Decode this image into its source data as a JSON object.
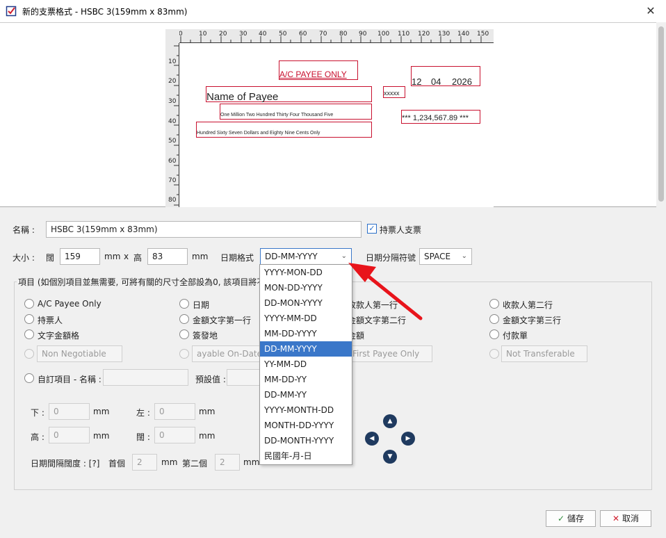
{
  "window": {
    "title": "新的支票格式 - HSBC 3(159mm x 83mm)"
  },
  "ruler": {
    "top_ticks": [
      "0",
      "10",
      "20",
      "30",
      "40",
      "50",
      "60",
      "70",
      "80",
      "90",
      "100",
      "110",
      "120",
      "130",
      "140",
      "150"
    ],
    "left_ticks": [
      "10",
      "20",
      "30",
      "40",
      "50",
      "60",
      "70",
      "80"
    ]
  },
  "cheque": {
    "ac_payee": "A/C PAYEE ONLY",
    "date_day": "12",
    "date_month": "04",
    "date_year": "2026",
    "payee": "Name of Payee",
    "xxxxx": "xxxxx",
    "words_line1": "One Million Two Hundred Thirty Four Thousand Five",
    "amount": "*** 1,234,567.89 ***",
    "words_line2": "Hundred Sixty Seven Dollars and Eighty Nine Cents Only"
  },
  "form": {
    "name_label": "名稱 :",
    "name_value": "HSBC 3(159mm x 83mm)",
    "bearer_label": "持票人支票",
    "size_label": "大小 :",
    "width_label": "闊",
    "width_value": "159",
    "mm1": "mm",
    "x": "x",
    "height_label": "高",
    "height_value": "83",
    "mm2": "mm",
    "date_format_label": "日期格式",
    "date_format_value": "DD-MM-YYYY",
    "date_sep_label": "日期分隔符號",
    "date_sep_value": "SPACE",
    "items_legend": "項目 (如個別項目並無需要, 可將有關的尺寸全部設為0, 該項目將不",
    "radios": {
      "ac_payee": "A/C Payee Only",
      "date": "日期",
      "payee2_partial": "收款人第一行",
      "payee_line2": "收款人第二行",
      "bearer": "持票人",
      "words1": "金額文字第一行",
      "words2_partial": "金額文字第二行",
      "words3": "金額文字第三行",
      "amount_words": "文字金額格",
      "sign": "簽發地",
      "amount_partial": "金額",
      "pay_slip": "付款單"
    },
    "disabled_inputs": {
      "non_negotiable": "Non Negotiable",
      "payable_on_date": "ayable On-Date O",
      "first_payee": "First Payee Only",
      "not_transferable": "Not Transferable"
    },
    "custom_label": "自訂項目 - 名稱 :",
    "default_label": "預設值 :",
    "bottom_label": "下 :",
    "bottom_value": "0",
    "mm_a": "mm",
    "left_label": "左 :",
    "left_value": "0",
    "mm_b": "mm",
    "h_label": "高 :",
    "h_value": "0",
    "mm_c": "mm",
    "w_label": "闊 :",
    "w_value": "0",
    "mm_d": "mm",
    "spacing_label": "日期間隔闊度 : [?]",
    "first_label": "首個",
    "first_value": "2",
    "mm_e": "mm",
    "second_label": "第二個",
    "second_value": "2",
    "mm_f": "mm"
  },
  "dropdown_options": [
    "YYYY-MON-DD",
    "MON-DD-YYYY",
    "DD-MON-YYYY",
    "YYYY-MM-DD",
    "MM-DD-YYYY",
    "DD-MM-YYYY",
    "YY-MM-DD",
    "MM-DD-YY",
    "DD-MM-YY",
    "YYYY-MONTH-DD",
    "MONTH-DD-YYYY",
    "DD-MONTH-YYYY",
    "民國年-月-日"
  ],
  "buttons": {
    "save": "儲存",
    "cancel": "取消"
  },
  "colors": {
    "field_border": "#c8102e",
    "selected": "#3a77c9",
    "arrow_red": "#e8141b"
  }
}
